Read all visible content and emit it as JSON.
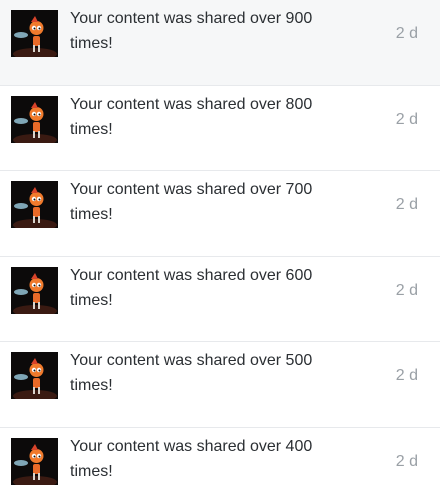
{
  "notifications": [
    {
      "text": "Your content was shared over 900 times!",
      "time": "2 d",
      "thumbnail_icon": "character-thumbnail-icon"
    },
    {
      "text": "Your content was shared over 800 times!",
      "time": "2 d",
      "thumbnail_icon": "character-thumbnail-icon"
    },
    {
      "text": "Your content was shared over 700 times!",
      "time": "2 d",
      "thumbnail_icon": "character-thumbnail-icon"
    },
    {
      "text": "Your content was shared over 600 times!",
      "time": "2 d",
      "thumbnail_icon": "character-thumbnail-icon"
    },
    {
      "text": "Your content was shared over 500 times!",
      "time": "2 d",
      "thumbnail_icon": "character-thumbnail-icon"
    },
    {
      "text": "Your content was shared over 400 times!",
      "time": "2 d",
      "thumbnail_icon": "character-thumbnail-icon"
    }
  ],
  "colors": {
    "text": "#2b2f33",
    "timestamp": "#9aa0a6",
    "first_row_bg": "#f6f7f8",
    "divider": "#e7e9ec"
  }
}
